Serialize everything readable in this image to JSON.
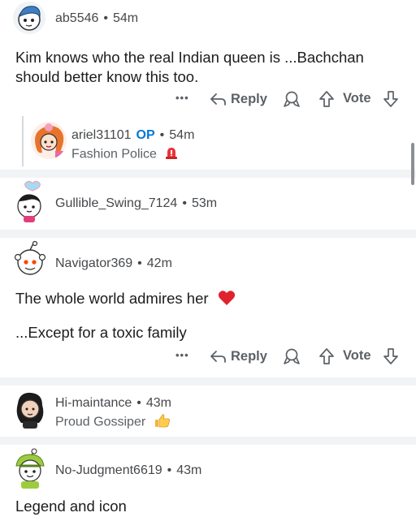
{
  "comments": [
    {
      "username": "ab5546",
      "time": "54m",
      "body_lines": [
        "Kim knows who the real Indian queen is ...Bachchan",
        "should better know this too."
      ]
    },
    {
      "username": "ariel31101",
      "op_label": "OP",
      "time": "54m",
      "flair": "Fashion Police"
    },
    {
      "username": "Gullible_Swing_7124",
      "time": "53m"
    },
    {
      "username": "Navigator369",
      "time": "42m",
      "body_lines": [
        "The whole world admires her",
        "...Except for a toxic family"
      ]
    },
    {
      "username": "Hi-maintance",
      "time": "43m",
      "flair": "Proud Gossiper"
    },
    {
      "username": "No-Judgment6619",
      "time": "43m",
      "body_lines": [
        "Legend and icon"
      ]
    }
  ],
  "actions": {
    "more": "•••",
    "reply": "Reply",
    "vote": "Vote"
  },
  "separator_dot": "•",
  "colors": {
    "separator": "#f2f3f5",
    "op_blue": "#0079d3",
    "meta_gray": "#5c6166"
  }
}
